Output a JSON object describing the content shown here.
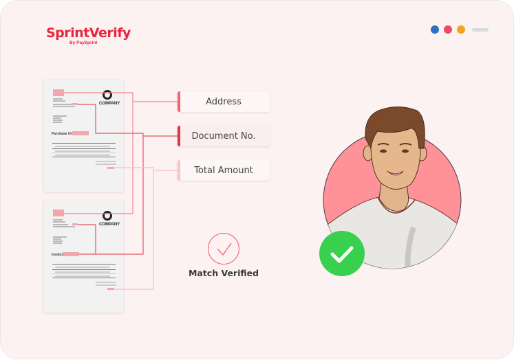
{
  "brand": {
    "name": "SprintVerify",
    "tagline": "By PaySprint",
    "color": "#e8263b"
  },
  "window_dots": {
    "colors": [
      "#2f6fc0",
      "#ea4c63",
      "#f5a21f"
    ],
    "bar_color": "#d9dbde"
  },
  "documents": [
    {
      "company": "COMPANY",
      "title": "Purchase Order"
    },
    {
      "company": "COMPANY",
      "title": "Invoice"
    }
  ],
  "fields": [
    {
      "label": "Address",
      "accent": "#f06471"
    },
    {
      "label": "Document No.",
      "accent": "#d93847"
    },
    {
      "label": "Total Amount",
      "accent": "#f9c3c7"
    }
  ],
  "status": {
    "label": "Match Verified",
    "icon": "check-circle-icon",
    "color": "#ef5d68"
  },
  "avatar": {
    "badge_icon": "check-icon",
    "badge_color": "#3ad04f",
    "bg_color": "#fe9298"
  }
}
